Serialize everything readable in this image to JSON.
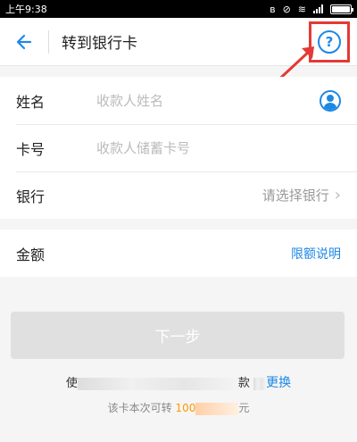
{
  "status_bar": {
    "time": "上午9:38",
    "battery_level": 1.0
  },
  "nav": {
    "title": "转到银行卡",
    "help_symbol": "?"
  },
  "form": {
    "name": {
      "label": "姓名",
      "placeholder": "收款人姓名"
    },
    "card": {
      "label": "卡号",
      "placeholder": "收款人储蓄卡号"
    },
    "bank": {
      "label": "银行",
      "placeholder": "请选择银行"
    },
    "amount": {
      "label": "金额",
      "limit_link": "限额说明"
    }
  },
  "next_button": "下一步",
  "hint": {
    "use_prefix": "使",
    "use_suffix": "款",
    "switch_link": "更换",
    "limit_prefix": "该卡本次可转",
    "limit_amount": "100",
    "limit_unit": "元"
  },
  "colors": {
    "accent": "#1e88e5",
    "highlight": "#e53935",
    "amount": "#ff9800"
  }
}
